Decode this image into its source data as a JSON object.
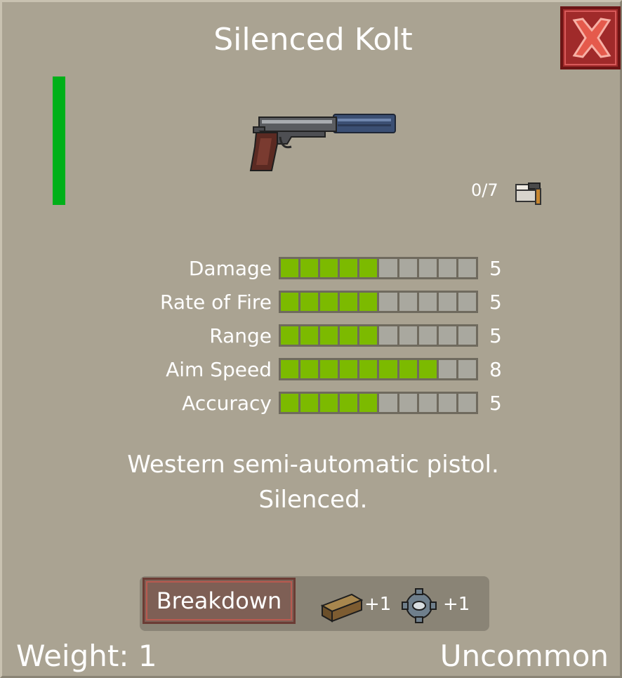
{
  "item": {
    "name": "Silenced Kolt",
    "description_line1": "Western semi-automatic pistol.",
    "description_line2": "Silenced.",
    "durability_fraction": 1.0,
    "ammo": "0/7",
    "weight_label": "Weight: 1",
    "rarity": "Uncommon"
  },
  "stats": [
    {
      "label": "Damage",
      "value": "5",
      "level": 5,
      "max": 10
    },
    {
      "label": "Rate of Fire",
      "value": "5",
      "level": 5,
      "max": 10
    },
    {
      "label": "Range",
      "value": "5",
      "level": 5,
      "max": 10
    },
    {
      "label": "Aim Speed",
      "value": "8",
      "level": 8,
      "max": 10
    },
    {
      "label": "Accuracy",
      "value": "5",
      "level": 5,
      "max": 10
    }
  ],
  "breakdown": {
    "button_label": "Breakdown",
    "results": [
      {
        "icon": "wood-plank-icon",
        "amount": "+1"
      },
      {
        "icon": "gear-icon",
        "amount": "+1"
      }
    ]
  },
  "colors": {
    "panel": "#aaa392",
    "durability": "#00b019",
    "stat_fill": "#7cba00",
    "stat_empty": "#a9a89f",
    "close_button": "#a02a2a"
  }
}
